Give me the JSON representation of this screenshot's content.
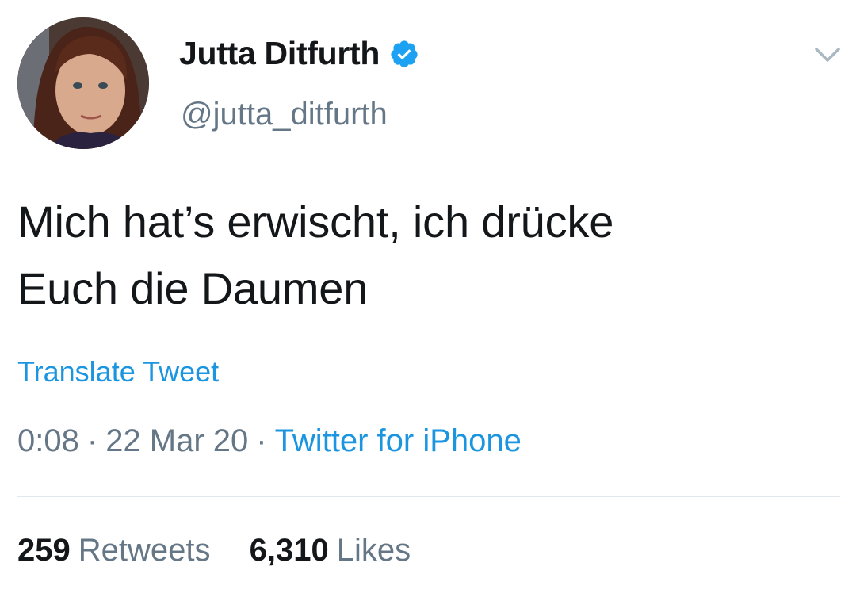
{
  "author": {
    "display_name": "Jutta Ditfurth",
    "handle": "@jutta_ditfurth",
    "verified": true,
    "verified_badge_icon": "verified-badge-icon",
    "avatar_icon": "profile-photo"
  },
  "menu": {
    "icon": "chevron-down-icon"
  },
  "tweet": {
    "text_lines": [
      "Mich hat’s erwischt, ich drücke",
      "Euch die Daumen"
    ],
    "translate_label": "Translate Tweet",
    "time": "0:08",
    "date": "22 Mar 20",
    "separator": "·",
    "source": "Twitter for iPhone"
  },
  "stats": {
    "retweets_count": "259",
    "retweets_label": "Retweets",
    "likes_count": "6,310",
    "likes_label": "Likes"
  },
  "colors": {
    "text": "#14171a",
    "secondary": "#657786",
    "link": "#1b95e0",
    "verified": "#1da1f2",
    "divider": "#e1e8ed"
  }
}
